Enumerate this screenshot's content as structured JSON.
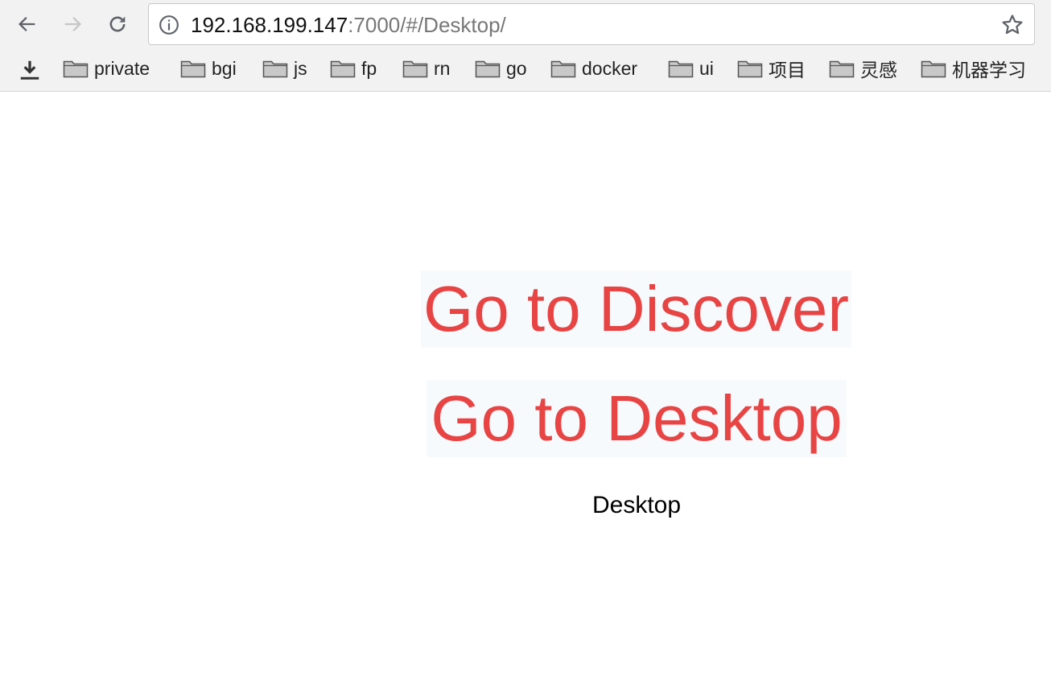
{
  "browser": {
    "url_host": "192.168.199.147",
    "url_rest": ":7000/#/Desktop/",
    "bookmarks": [
      "private",
      "bgi",
      "js",
      "fp",
      "rn",
      "go",
      "docker",
      "ui",
      "项目",
      "灵感",
      "机器学习"
    ]
  },
  "page": {
    "discover_link": "Go to Discover",
    "desktop_link": "Go to Desktop",
    "current_page": "Desktop"
  },
  "colors": {
    "link_text": "#e84444",
    "link_bg": "#f6fafd"
  }
}
